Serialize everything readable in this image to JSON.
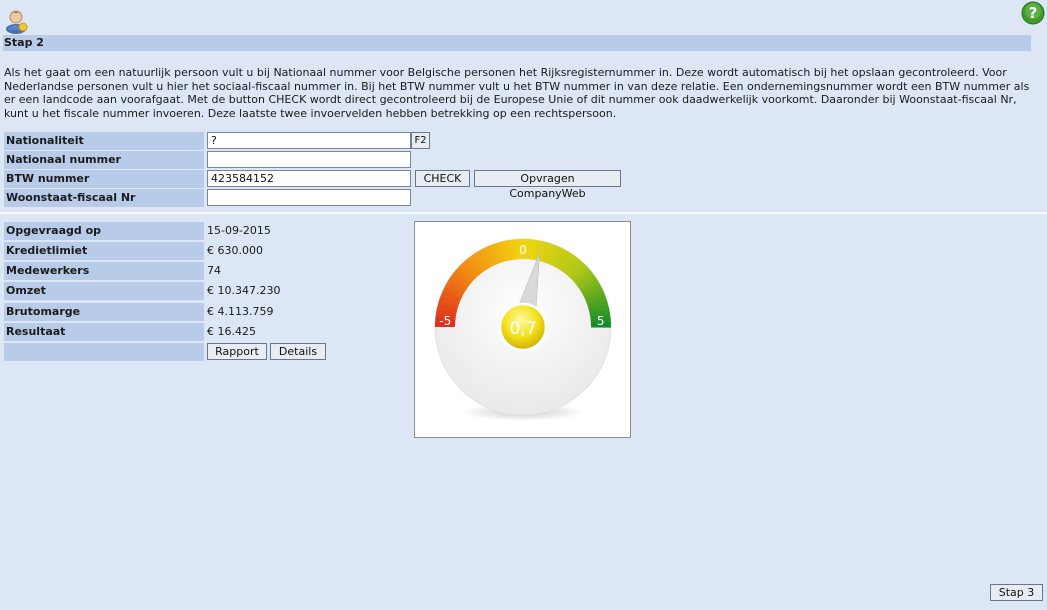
{
  "header": {
    "user_icon": "user-icon",
    "help_icon": "help-icon",
    "step_title": "Stap 2"
  },
  "intro": {
    "text": "Als het gaat om een natuurlijk persoon vult u bij Nationaal nummer voor Belgische personen het Rijksregisternummer in. Deze wordt automatisch bij het opslaan gecontroleerd. Voor Nederlandse personen vult u hier het sociaal-fiscaal nummer in. Bij het BTW nummer vult u het BTW nummer in van deze relatie. Een ondernemingsnummer wordt een BTW nummer als er een landcode aan voorafgaat. Met de button CHECK wordt direct gecontroleerd bij de Europese Unie of dit nummer ook daadwerkelijk voorkomt. Daaronder bij Woonstaat-fiscaal Nr, kunt u het fiscale nummer invoeren. Deze laatste twee invoervelden hebben betrekking op een rechtspersoon."
  },
  "form": {
    "nationaliteit": {
      "label": "Nationaliteit",
      "value": "?",
      "lookup_label": "F2"
    },
    "nationaal_nummer": {
      "label": "Nationaal nummer",
      "value": ""
    },
    "btw_nummer": {
      "label": "BTW nummer",
      "value": "423584152",
      "check_label": "CHECK",
      "companyweb_label": "Opvragen CompanyWeb"
    },
    "woonstaat": {
      "label": "Woonstaat-fiscaal Nr",
      "value": ""
    }
  },
  "company": {
    "rows": [
      {
        "label": "Opgevraagd op",
        "value": "15-09-2015"
      },
      {
        "label": "Kredietlimiet",
        "value": "€ 630.000"
      },
      {
        "label": "Medewerkers",
        "value": "74"
      },
      {
        "label": "Omzet",
        "value": "€ 10.347.230"
      },
      {
        "label": "Brutomarge",
        "value": "€ 4.113.759"
      },
      {
        "label": "Resultaat",
        "value": "€ 16.425"
      }
    ],
    "rapport_label": "Rapport",
    "details_label": "Details"
  },
  "gauge": {
    "min_label": "-5",
    "mid_label": "0",
    "max_label": "5",
    "min": -5,
    "max": 5,
    "value": 0.7,
    "value_label": "0,7"
  },
  "footer": {
    "next_label": "Stap 3"
  }
}
